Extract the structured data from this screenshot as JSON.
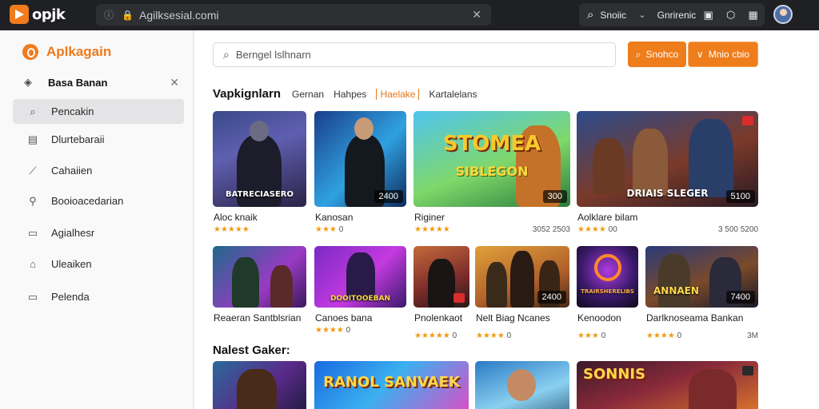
{
  "browser": {
    "logo_text": "opjk",
    "url": "Agilksesial.comi",
    "search_label": "Snoiic",
    "menu_label": "Gnrirenic"
  },
  "sidebar": {
    "brand": "Aplkagain",
    "section_label": "Basa Banan",
    "items": [
      {
        "label": "Pencakin",
        "icon": "search-icon"
      },
      {
        "label": "Dlurtebaraii",
        "icon": "document-icon"
      },
      {
        "label": "Cahaiien",
        "icon": "tag-icon"
      },
      {
        "label": "Booioacedarian",
        "icon": "link-icon"
      },
      {
        "label": "Agialhesr",
        "icon": "monitor-icon"
      },
      {
        "label": "Uleaiken",
        "icon": "lock-icon"
      },
      {
        "label": "Pelenda",
        "icon": "window-icon"
      }
    ]
  },
  "main": {
    "search_placeholder": "Berngel lslhnarn",
    "buttons": [
      {
        "label": "Snohco",
        "icon": "search-icon"
      },
      {
        "label": "Mnio cbio",
        "icon": "chevron-down-icon"
      }
    ],
    "tabs_heading": "Vapkignlarn",
    "tabs": [
      "Gernan",
      "Hahpes",
      "Haelake",
      "Kartalelans"
    ],
    "active_tab": "Haelake",
    "section2_heading": "Nalest Gaker:",
    "row1": [
      {
        "title": "Aloc knaik",
        "rating": "★★★★★",
        "extra": "",
        "caption": "BATRECIASERO",
        "badge": "",
        "price": ""
      },
      {
        "title": "Kanosan",
        "rating": "★★★",
        "extra": "0",
        "caption": "",
        "badge": "2400",
        "price": ""
      },
      {
        "title": "Riginer",
        "rating": "★★★★★",
        "extra": "",
        "caption": "STOMEA",
        "caption2": "SIBLEGON",
        "badge": "300",
        "price": "3052 2503"
      },
      {
        "title": "Aolklare bilam",
        "rating": "★★★★",
        "extra": "00",
        "caption": "DRIAIS SLEGER",
        "badge": "5100",
        "price": "3 500 5200"
      }
    ],
    "row2": [
      {
        "title": "Reaeran Santblsrian",
        "rating": "",
        "extra": "",
        "caption": "",
        "badge": ""
      },
      {
        "title": "Canoes bana",
        "rating": "★★★★",
        "extra": "0",
        "caption": "DOOITOOEBAN",
        "badge": ""
      },
      {
        "title": "Pnolenkaot",
        "rating": "★★★★★",
        "extra": "0",
        "caption": "",
        "badge": ""
      },
      {
        "title": "Nelt Biag Ncanes",
        "rating": "★★★★",
        "extra": "0",
        "caption": "",
        "badge": "2400"
      },
      {
        "title": "Kenoodon",
        "rating": "★★★",
        "extra": "0",
        "caption": "TRAIRSHERELIBS",
        "badge": ""
      },
      {
        "title": "Darlknoseama Bankan",
        "rating": "★★★★",
        "extra": "0",
        "caption": "ANNAEN",
        "badge": "7400",
        "price": "3M"
      }
    ],
    "row3": [
      {
        "caption": ""
      },
      {
        "caption": "RANOL SANVAEK"
      },
      {
        "caption": ""
      },
      {
        "caption": "SONNIS"
      }
    ]
  },
  "colors": {
    "accent": "#ee7d1c",
    "topbar": "#1f2023",
    "star": "#ee9b12"
  }
}
